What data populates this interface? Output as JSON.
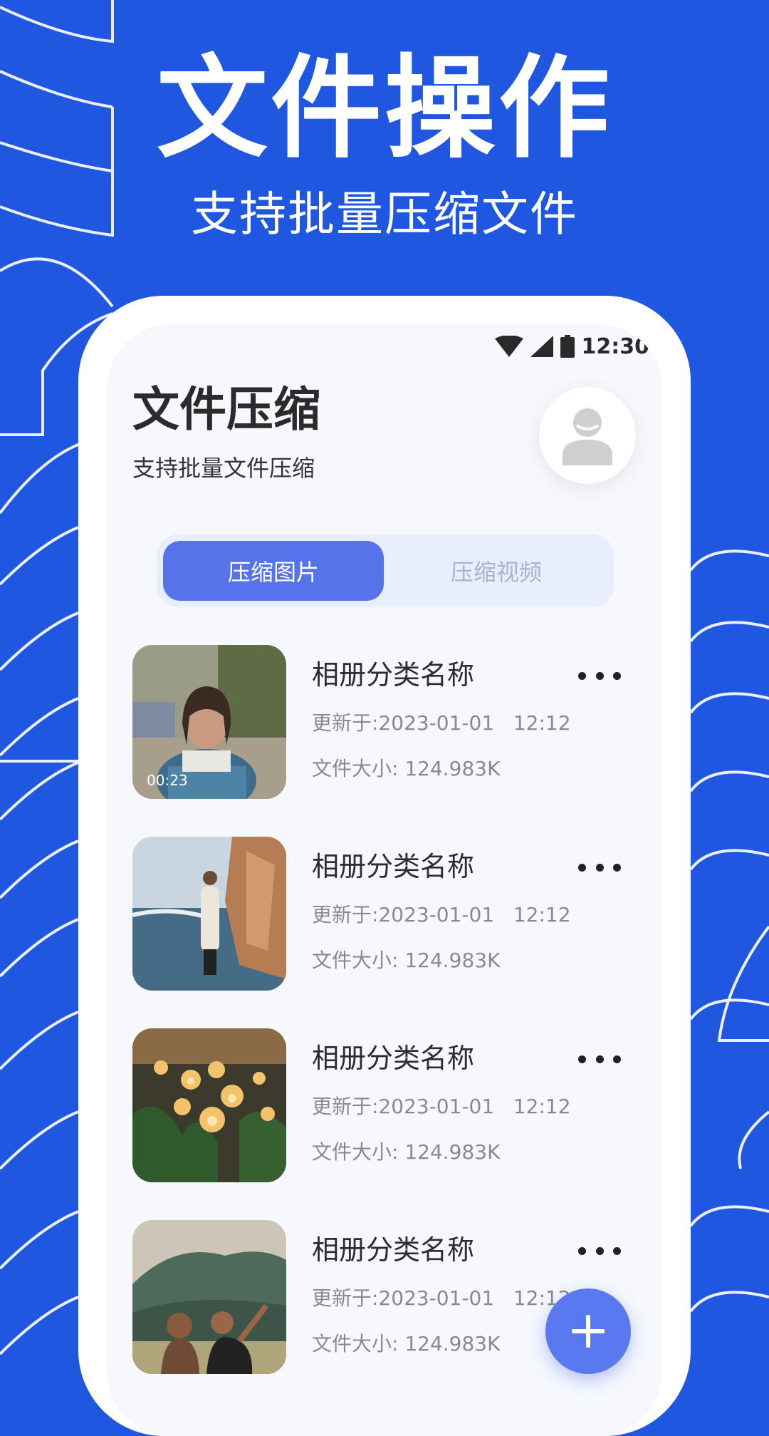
{
  "hero": {
    "title": "文件操作",
    "subtitle": "支持批量压缩文件"
  },
  "status_bar": {
    "time": "12:30",
    "icons": [
      "wifi-icon",
      "signal-icon",
      "battery-icon"
    ]
  },
  "header": {
    "title": "文件压缩",
    "subtitle": "支持批量文件压缩",
    "avatar_icon": "user-avatar-icon"
  },
  "tabs": {
    "active": "压缩图片",
    "inactive": "压缩视频"
  },
  "items": [
    {
      "title": "相册分类名称",
      "updated": "更新于:2023-01-01   12:12",
      "size": "文件大小: 124.983K",
      "duration": "00:23"
    },
    {
      "title": "相册分类名称",
      "updated": "更新于:2023-01-01   12:12",
      "size": "文件大小: 124.983K"
    },
    {
      "title": "相册分类名称",
      "updated": "更新于:2023-01-01   12:12",
      "size": "文件大小: 124.983K"
    },
    {
      "title": "相册分类名称",
      "updated": "更新于:2023-01-01   12:12",
      "size": "文件大小: 124.983K"
    }
  ],
  "fab": {
    "icon": "plus-icon"
  },
  "colors": {
    "background": "#1f57e0",
    "accent": "#5673ea",
    "fab": "#5a78f0",
    "screen": "#f6f8fe"
  }
}
